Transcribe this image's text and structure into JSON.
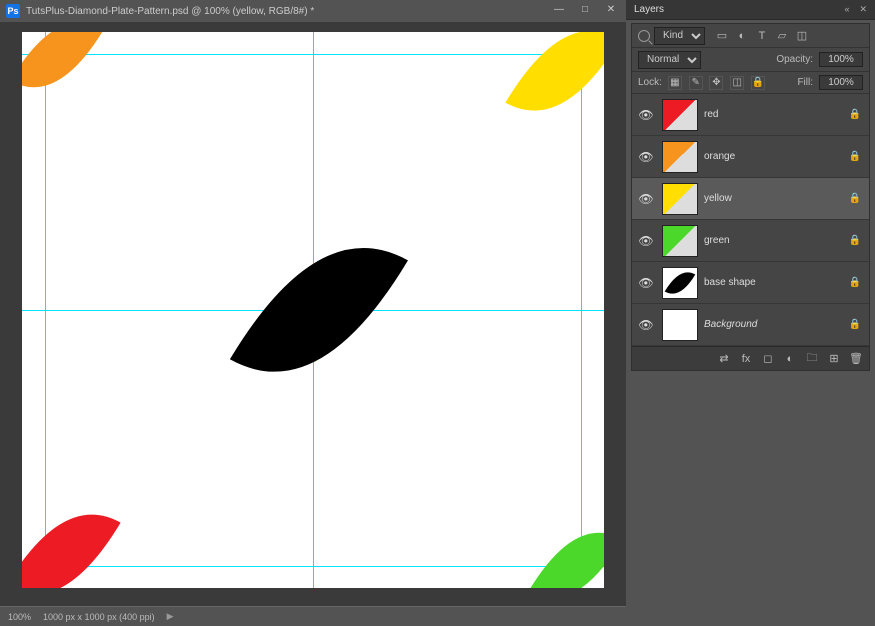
{
  "window": {
    "title": "TutsPlus-Diamond-Plate-Pattern.psd @ 100% (yellow, RGB/8#) *"
  },
  "statusbar": {
    "zoom": "100%",
    "docinfo": "1000 px x 1000 px (400 ppi)"
  },
  "canvas": {
    "guides": {
      "v_margin_left_pct": 4,
      "v_center_pct": 50,
      "v_margin_right_pct": 96,
      "h_margin_top_pct": 4,
      "h_center_pct": 50,
      "h_margin_bottom_pct": 96
    },
    "shapes": {
      "center_black": "#000000",
      "top_left": "#f7941d",
      "top_right": "#ffde00",
      "bottom_left": "#ed1c24",
      "bottom_right": "#4cd82b"
    }
  },
  "layers_panel": {
    "title": "Layers",
    "filter_kind": "Kind",
    "blend_mode": "Normal",
    "opacity_label": "Opacity:",
    "opacity_value": "100%",
    "lock_label": "Lock:",
    "fill_label": "Fill:",
    "fill_value": "100%",
    "layers": [
      {
        "name": "red",
        "selected": false,
        "visible": true,
        "color": "#ed1c24",
        "italic": false
      },
      {
        "name": "orange",
        "selected": false,
        "visible": true,
        "color": "#f7941d",
        "italic": false
      },
      {
        "name": "yellow",
        "selected": true,
        "visible": true,
        "color": "#ffde00",
        "italic": false
      },
      {
        "name": "green",
        "selected": false,
        "visible": true,
        "color": "#4cd82b",
        "italic": false
      },
      {
        "name": "base shape",
        "selected": false,
        "visible": true,
        "color": "#000000",
        "italic": false
      },
      {
        "name": "Background",
        "selected": false,
        "visible": true,
        "color": null,
        "italic": true
      }
    ]
  }
}
